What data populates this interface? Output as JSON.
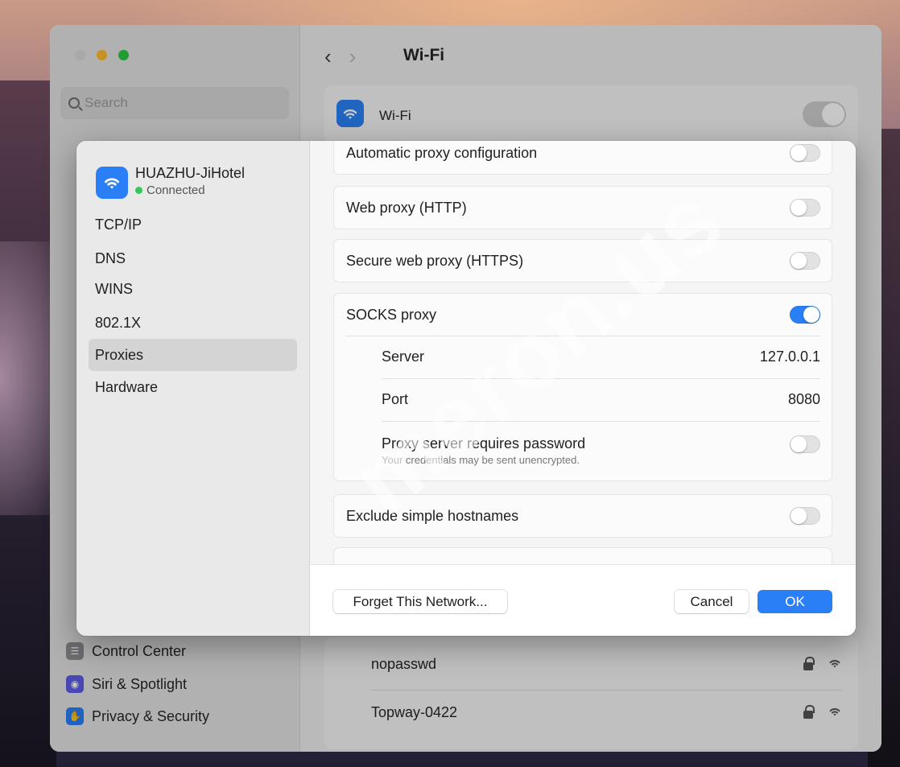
{
  "background_window": {
    "search_placeholder": "Search",
    "title": "Wi-Fi",
    "wifi_label": "Wi-Fi",
    "sidebar_items": [
      {
        "label": "Control Center",
        "icon": "control-center-icon",
        "color": "#8e8e93"
      },
      {
        "label": "Siri & Spotlight",
        "icon": "siri-icon",
        "color": "#5e5ce6"
      },
      {
        "label": "Privacy & Security",
        "icon": "hand-icon",
        "color": "#2a7ef6"
      }
    ],
    "networks": [
      {
        "name": "nopasswd"
      },
      {
        "name": "Topway-0422"
      }
    ]
  },
  "sheet": {
    "network_name": "HUAZHU-JiHotel",
    "network_status": "Connected",
    "menu": [
      {
        "label": "TCP/IP"
      },
      {
        "label": "DNS"
      },
      {
        "label": "WINS"
      },
      {
        "label": "802.1X"
      },
      {
        "label": "Proxies"
      },
      {
        "label": "Hardware"
      }
    ],
    "active_menu": "Proxies",
    "proxies": {
      "auto_config": {
        "label": "Automatic proxy configuration",
        "on": false
      },
      "web_http": {
        "label": "Web proxy (HTTP)",
        "on": false
      },
      "secure_https": {
        "label": "Secure web proxy (HTTPS)",
        "on": false
      },
      "socks": {
        "label": "SOCKS proxy",
        "on": true,
        "server_label": "Server",
        "server_value": "127.0.0.1",
        "port_label": "Port",
        "port_value": "8080",
        "password_label": "Proxy server requires password",
        "password_note": "Your credentials may be sent unencrypted.",
        "password_on": false
      },
      "exclude_simple": {
        "label": "Exclude simple hostnames",
        "on": false
      }
    },
    "buttons": {
      "forget": "Forget This Network...",
      "cancel": "Cancel",
      "ok": "OK"
    }
  },
  "watermark": "meron.us",
  "colors": {
    "accent": "#2a7ef6",
    "connected": "#34c759"
  }
}
